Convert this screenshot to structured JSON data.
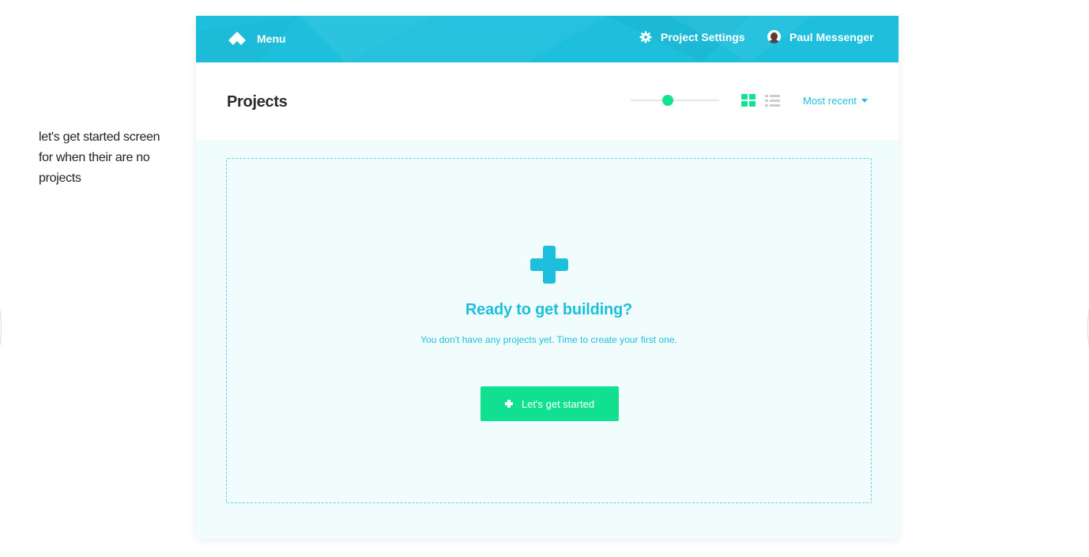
{
  "annotation_note": "let's get started screen for when their are no projects",
  "topbar": {
    "menu_label": "Menu",
    "menu_icon": "logo-diamond-icon",
    "settings_label": "Project Settings",
    "settings_icon": "gear-icon",
    "user_name": "Paul Messenger",
    "background_color": "#1dbfdd"
  },
  "header": {
    "title": "Projects",
    "zoom_level": 0.42,
    "view_mode": "grid",
    "sort_label": "Most recent"
  },
  "empty_state": {
    "icon": "plus-icon",
    "heading": "Ready to get building?",
    "message": "You don't have any projects yet.  Time to create your first one.",
    "button_label": "Let's get started"
  },
  "colors": {
    "accent_cyan": "#1dbfdd",
    "accent_green": "#10e08f",
    "panel_background": "#f1fcfd"
  }
}
